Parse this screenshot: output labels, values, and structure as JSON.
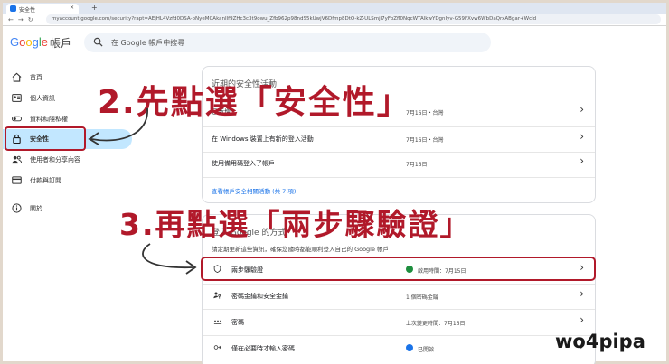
{
  "browser": {
    "tab_title": "安全性",
    "url": "myaccount.google.com/security?rapt=AEjHL4Vzfd0DSA-oNyeMCAkanIlf9ZHc3c3t9owu_Zfb962p98ndS5kUwjV6Dfmp8DtO-kZ-ULSmjl7yFoZfl0NqcWTAlkwYDgnIyv-G59FXvw6WbDaQrxABgar+Wcld"
  },
  "header": {
    "logo_text": "Google",
    "account_word": "帳戶",
    "search_placeholder": "在 Google 帳戶中搜尋"
  },
  "sidebar": {
    "items": [
      {
        "label": "首頁",
        "icon": "home-icon"
      },
      {
        "label": "個人資訊",
        "icon": "id-card-icon"
      },
      {
        "label": "資料和隱私權",
        "icon": "toggle-icon"
      },
      {
        "label": "安全性",
        "icon": "lock-icon",
        "active": true
      },
      {
        "label": "使用者和分享內容",
        "icon": "people-icon"
      },
      {
        "label": "付款與訂閱",
        "icon": "credit-card-icon"
      },
      {
        "label": "關於",
        "icon": "info-icon"
      }
    ]
  },
  "activity_card": {
    "title": "近期的安全性活動",
    "rows": [
      {
        "label": "已新增",
        "date": "7月16日・台灣"
      },
      {
        "label": "在 Windows 裝置上有新的登入活動",
        "date": "7月16日・台灣"
      },
      {
        "label": "使用備用碼登入了帳戶",
        "date": "7月16日"
      }
    ],
    "link": "查看帳戶安全相關活動 (共 7 項)"
  },
  "signin_card": {
    "title": "登入 Google 的方式",
    "description": "請定期更新這些資訊，確保您隨時都能順利登入自己的 Google 帳戶",
    "rows": [
      {
        "label": "兩步驟驗證",
        "status": "啟用時間：7月15日",
        "icon": "shield-icon",
        "status_icon": "check-green-icon"
      },
      {
        "label": "密碼金鑰和安全金鑰",
        "status": "1 個密碼金鑰",
        "icon": "passkey-icon"
      },
      {
        "label": "密碼",
        "status": "上次變更時間：7月16日",
        "icon": "password-dots-icon"
      },
      {
        "label": "僅在必要時才輸入密碼",
        "status": "已開啟",
        "icon": "skip-password-icon",
        "status_icon": "check-blue-icon"
      }
    ]
  },
  "annotations": {
    "step2": "2.先點選「安全性」",
    "step3": "3.再點選「兩步驟驗證」"
  },
  "watermark": "wo4pipa",
  "colors": {
    "annotation_red": "#b1192a",
    "active_nav": "#c2e7ff",
    "link_blue": "#1a73e8",
    "ok_green": "#1e8e3e"
  }
}
